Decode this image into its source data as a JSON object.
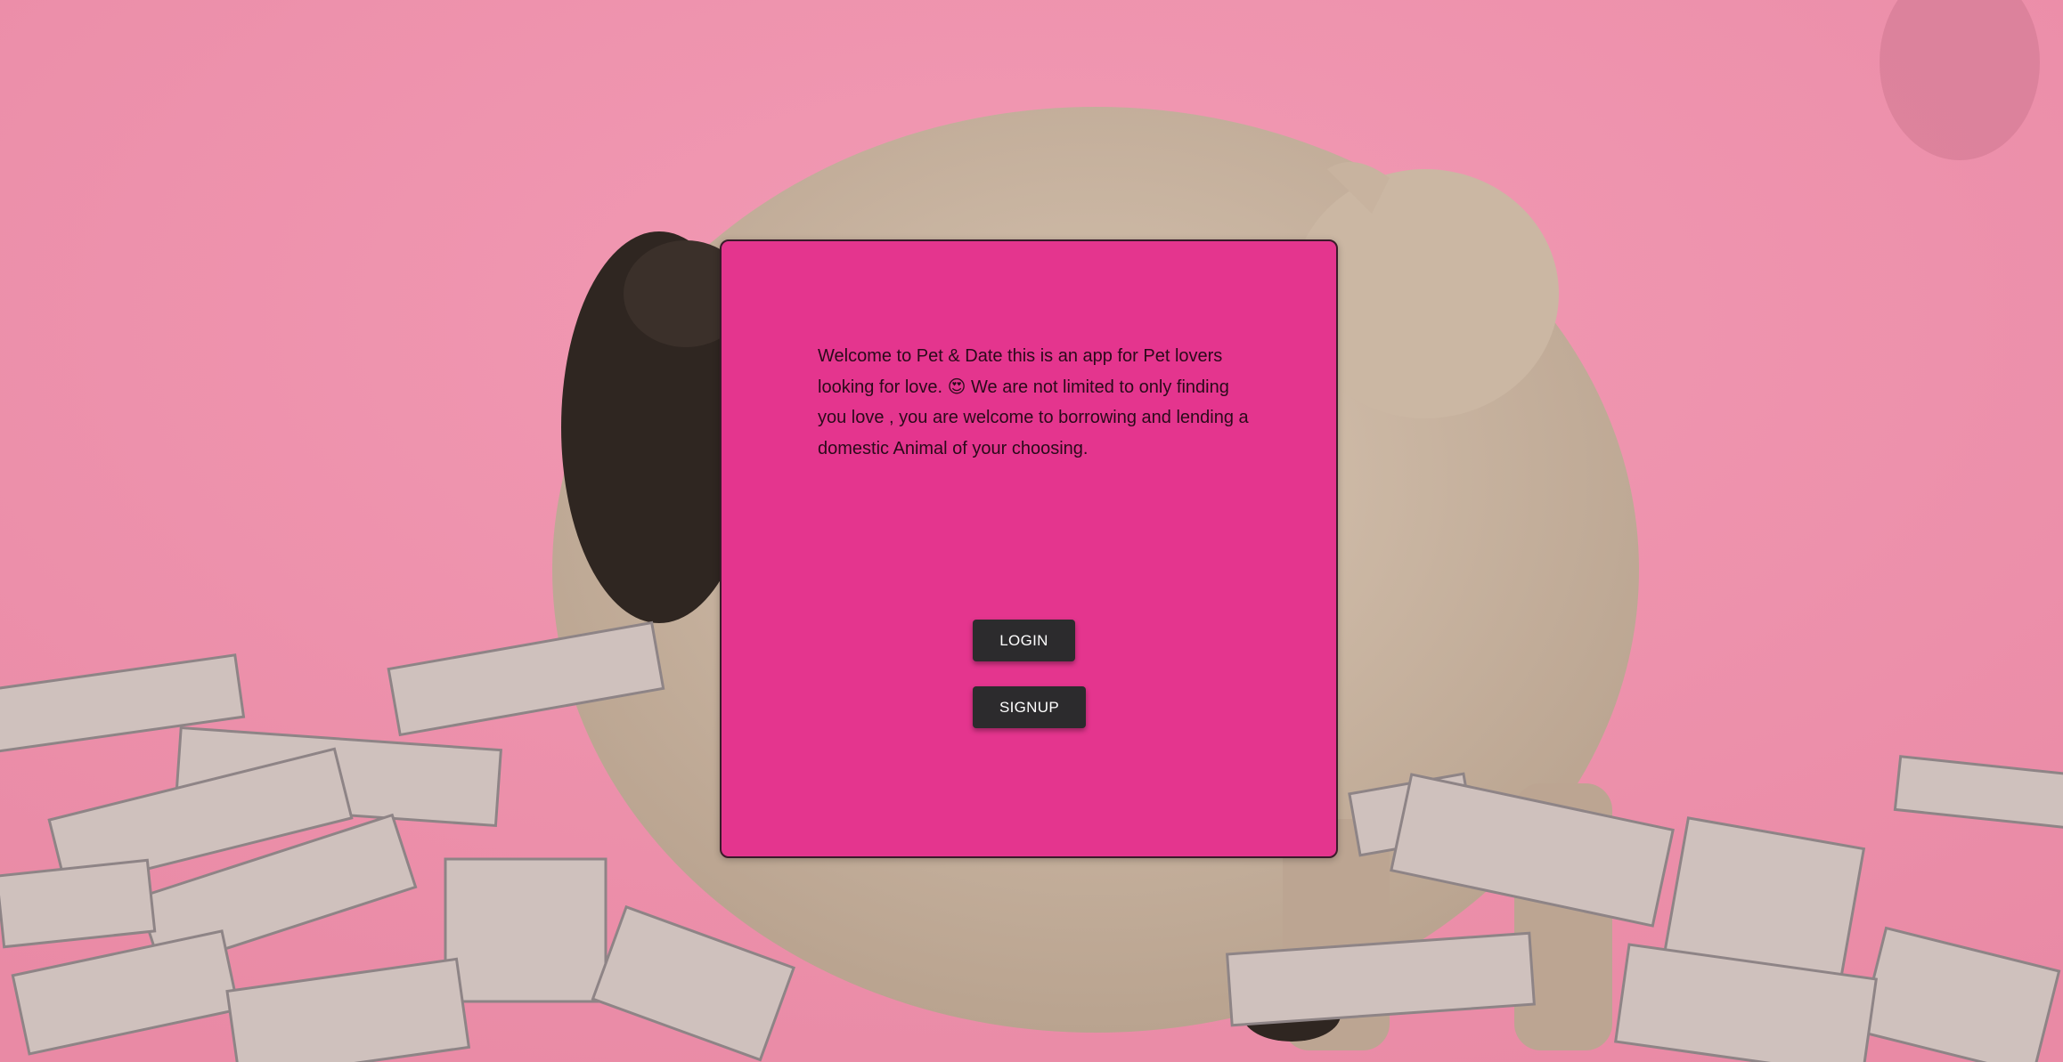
{
  "welcome": {
    "text": "Welcome to Pet & Date this is an app for Pet lovers looking for love. 😍 We are not limited to only finding you love , you are welcome to borrowing and lending a domestic Animal of your choosing."
  },
  "buttons": {
    "login_label": "LOGIN",
    "signup_label": "SIGNUP"
  },
  "colors": {
    "background_pink": "#ef93ae",
    "card_pink": "#e4358e",
    "button_dark": "#2c2b2d"
  }
}
